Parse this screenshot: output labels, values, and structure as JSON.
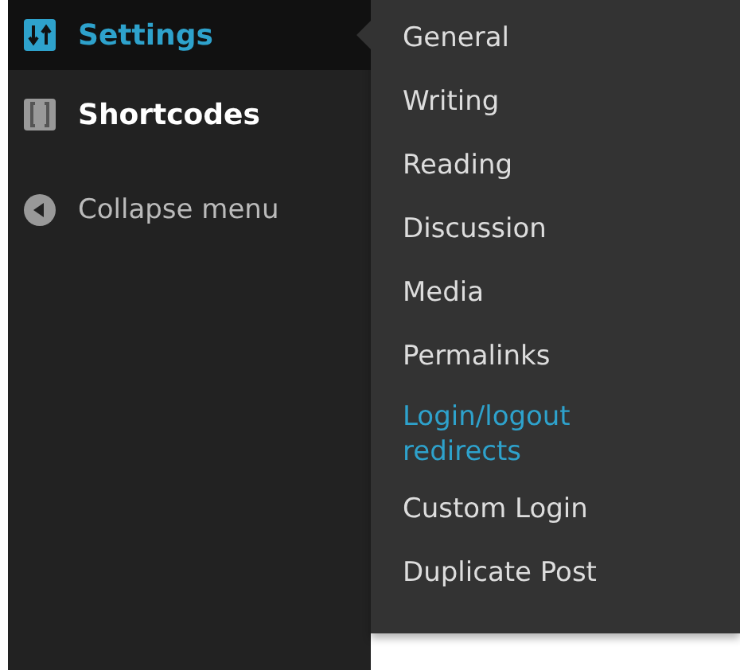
{
  "menu": [
    {
      "label": "Settings",
      "selected": true
    },
    {
      "label": "Shortcodes",
      "selected": false
    }
  ],
  "collapse_label": "Collapse menu",
  "submenu": [
    {
      "label": "General",
      "selected": false
    },
    {
      "label": "Writing",
      "selected": false
    },
    {
      "label": "Reading",
      "selected": false
    },
    {
      "label": "Discussion",
      "selected": false
    },
    {
      "label": "Media",
      "selected": false
    },
    {
      "label": "Permalinks",
      "selected": false
    },
    {
      "label": "Login/logout redirects",
      "selected": true
    },
    {
      "label": "Custom Login",
      "selected": false
    },
    {
      "label": "Duplicate Post",
      "selected": false
    }
  ]
}
